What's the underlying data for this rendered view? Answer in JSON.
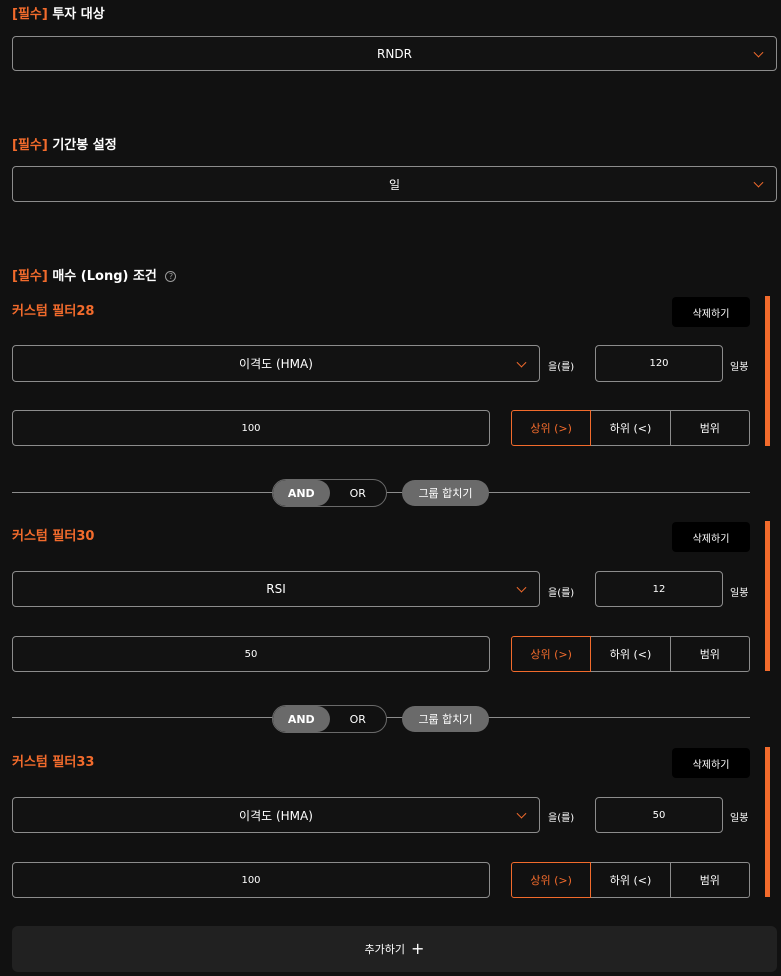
{
  "required_tag": "[필수]",
  "investment": {
    "label": "투자 대상",
    "value": "RNDR"
  },
  "period": {
    "label": "기간봉 설정",
    "value": "일"
  },
  "buy_condition": {
    "label": "매수 (Long) 조건",
    "help_icon": "?"
  },
  "filters": [
    {
      "title": "커스텀 필터28",
      "delete_label": "삭제하기",
      "indicator": "이격도 (HMA)",
      "particle": "을(를)",
      "period": "120",
      "period_unit": "일봉",
      "threshold": "100",
      "options": [
        "상위 (>)",
        "하위 (<)",
        "범위"
      ],
      "selected": 0
    },
    {
      "title": "커스텀 필터30",
      "delete_label": "삭제하기",
      "indicator": "RSI",
      "particle": "을(를)",
      "period": "12",
      "period_unit": "일봉",
      "threshold": "50",
      "options": [
        "상위 (>)",
        "하위 (<)",
        "범위"
      ],
      "selected": 0
    },
    {
      "title": "커스텀 필터33",
      "delete_label": "삭제하기",
      "indicator": "이격도 (HMA)",
      "particle": "을(를)",
      "period": "50",
      "period_unit": "일봉",
      "threshold": "100",
      "options": [
        "상위 (>)",
        "하위 (<)",
        "범위"
      ],
      "selected": 0
    }
  ],
  "connectors": [
    {
      "and_label": "AND",
      "or_label": "OR",
      "selected": "AND",
      "merge_label": "그룹 합치기"
    },
    {
      "and_label": "AND",
      "or_label": "OR",
      "selected": "AND",
      "merge_label": "그룹 합치기"
    }
  ],
  "add_button": {
    "label": "추가하기",
    "icon": "+"
  },
  "colors": {
    "accent": "#f26b2c",
    "background": "#111111",
    "border": "#8c8c8c",
    "pill": "#6a6a6a"
  }
}
